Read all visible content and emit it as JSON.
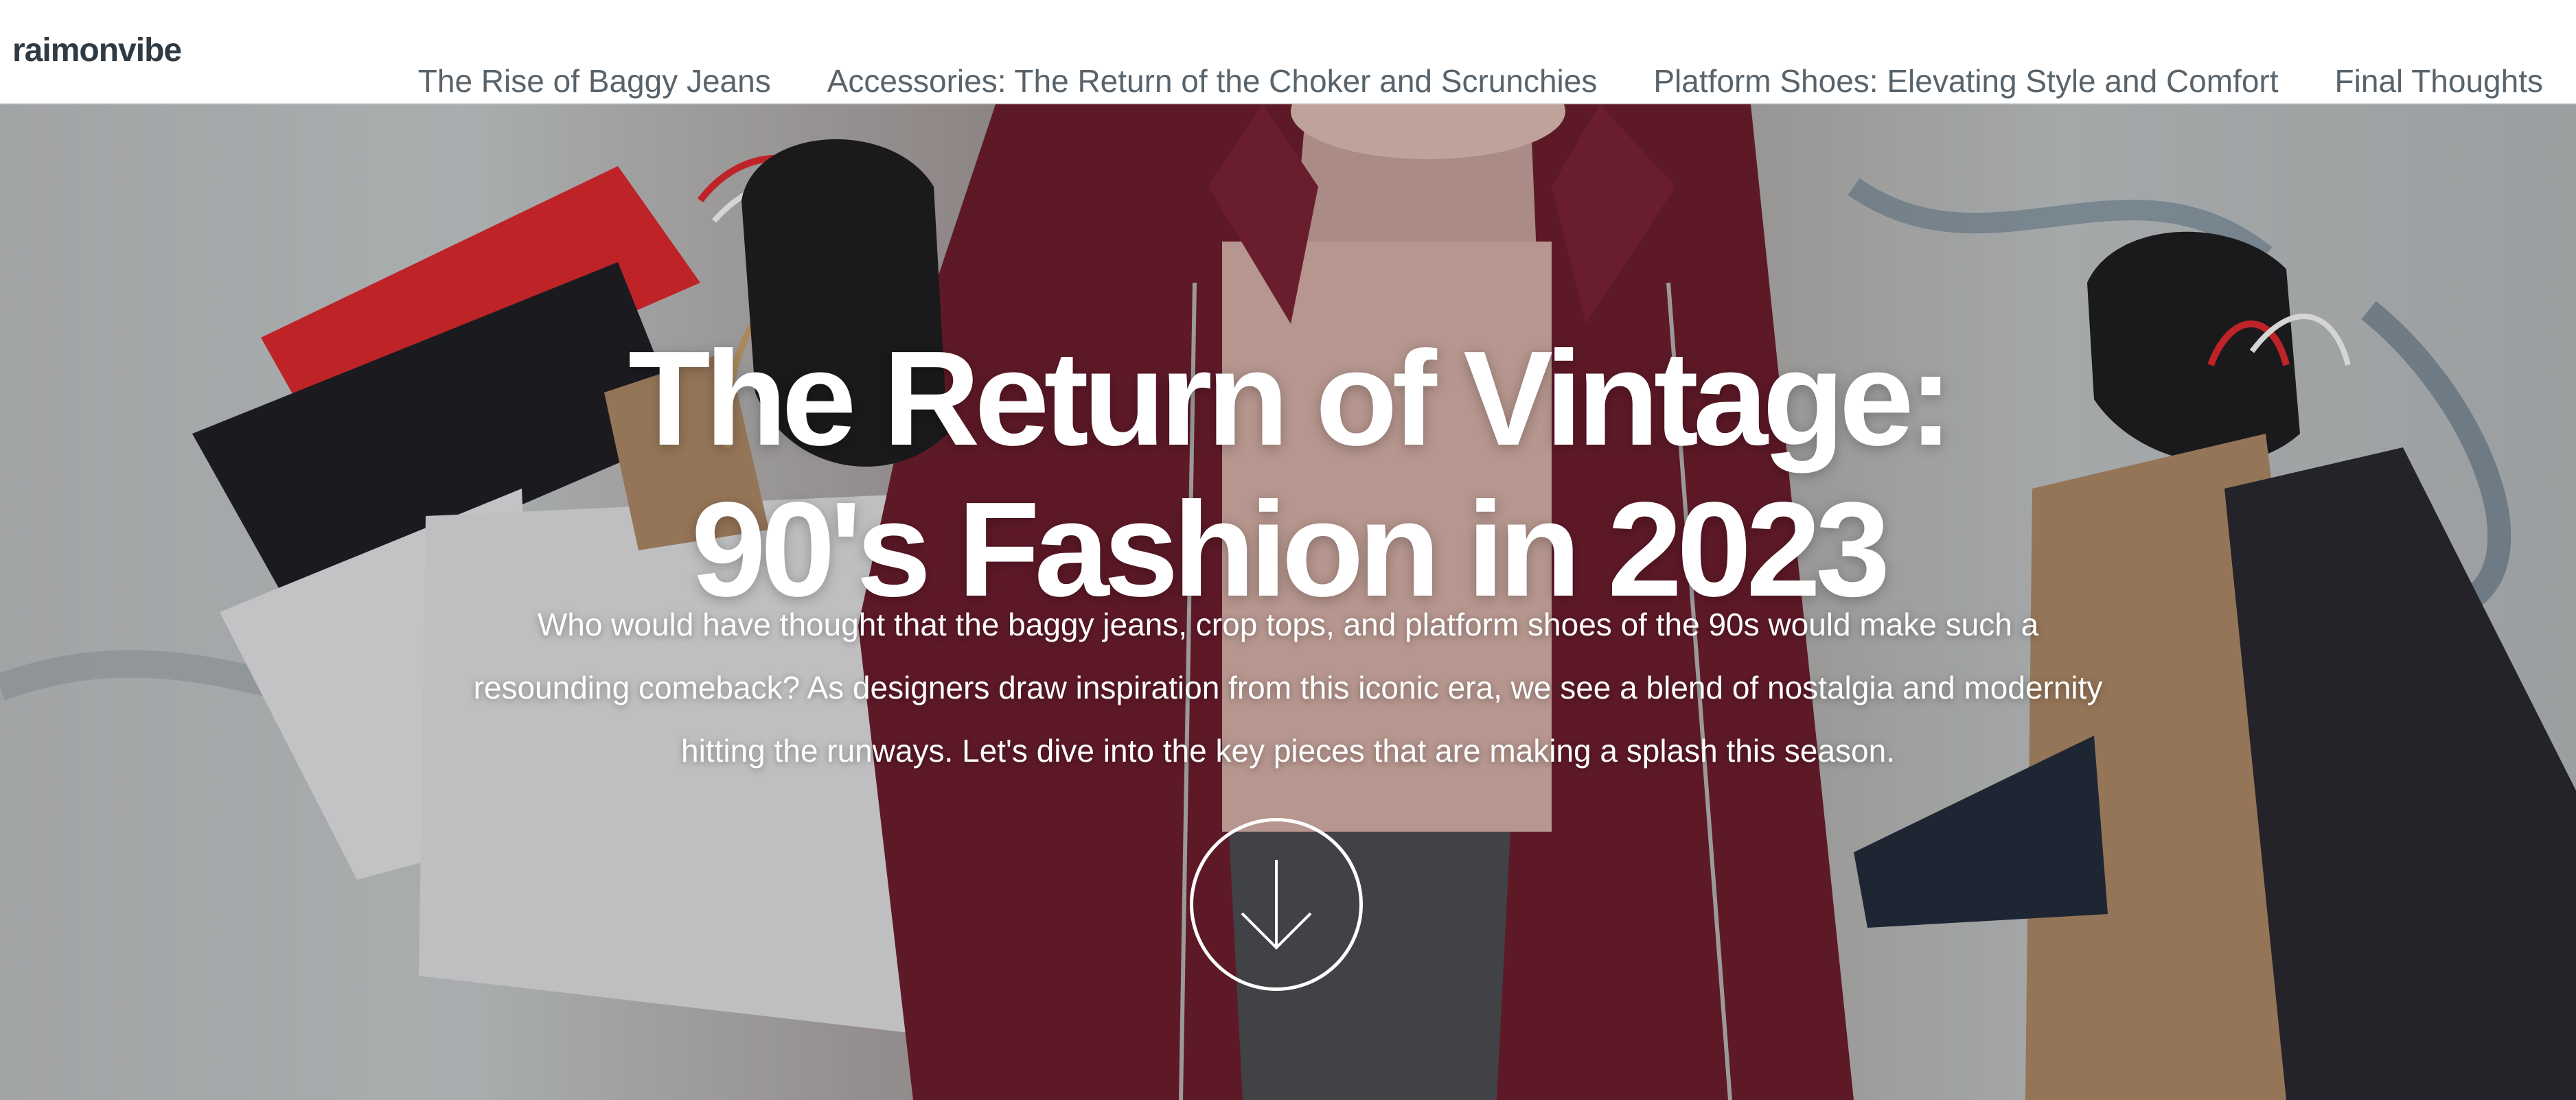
{
  "site": {
    "brand": "raimonvibe"
  },
  "nav": {
    "items": [
      {
        "label": "The Rise of Baggy Jeans"
      },
      {
        "label": "Accessories: The Return of the Choker and Scrunchies"
      },
      {
        "label": "Platform Shoes: Elevating Style and Comfort"
      },
      {
        "label": "Final Thoughts"
      }
    ]
  },
  "hero": {
    "title_line1": "The Return of Vintage:",
    "title_line2": "90's Fashion in 2023",
    "intro": "Who would have thought that the baggy jeans, crop tops, and platform shoes of the 90s would make such a resounding comeback? As designers draw inspiration from this iconic era, we see a blend of nostalgia and modernity hitting the runways. Let's dive into the key pieces that are making a splash this season.",
    "scroll_icon": "arrow-down-icon"
  },
  "colors": {
    "header_bg": "#ffffff",
    "brand_text": "#2f3b44",
    "nav_text": "#59636b",
    "hero_text": "#ffffff",
    "coat": "#6d1a2a",
    "bag_red": "#e2262b",
    "bag_black": "#1c1d20",
    "bag_white": "#e3e5e6",
    "bag_kraft": "#b08a66"
  }
}
